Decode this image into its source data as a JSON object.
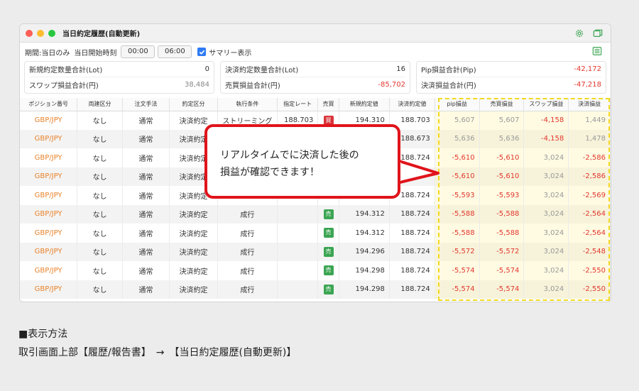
{
  "window": {
    "title": "当日約定履歴(自動更新)",
    "icons": [
      "gear-icon",
      "window-icon"
    ]
  },
  "filter": {
    "period_label": "期間:当日のみ",
    "start_label": "当日開始時刻",
    "time_from": "00:00",
    "time_to": "06:00",
    "summary_label": "サマリー表示",
    "summary_checked": true
  },
  "summary": [
    [
      {
        "label": "新規約定数量合計(Lot)",
        "value": "0"
      },
      {
        "label": "スワップ損益合計(円)",
        "value": "38,484"
      }
    ],
    [
      {
        "label": "決済約定数量合計(Lot)",
        "value": "16"
      },
      {
        "label": "売買損益合計(円)",
        "value": "-85,702"
      }
    ],
    [
      {
        "label": "Pip損益合計(Pip)",
        "value": "-42,172"
      },
      {
        "label": "決済損益合計(円)",
        "value": "-47,218"
      }
    ]
  ],
  "table": {
    "headers": [
      "ポジション番号",
      "両建区分",
      "注文手法",
      "約定区分",
      "執行条件",
      "指定レート",
      "売買",
      "新規約定値",
      "決済約定値",
      "pip損益",
      "売買損益",
      "スワップ損益",
      "決済損益"
    ],
    "rows": [
      [
        "GBP/JPY",
        "なし",
        "通常",
        "決済約定",
        "ストリーミング",
        "188.703",
        "買",
        "194.310",
        "188.703",
        "5,607",
        "5,607",
        "-4,158",
        "1,449"
      ],
      [
        "GBP/JPY",
        "なし",
        "通常",
        "決済約定",
        "",
        "",
        "",
        "",
        "188.673",
        "5,636",
        "5,636",
        "-4,158",
        "1,478"
      ],
      [
        "GBP/JPY",
        "なし",
        "通常",
        "決済約定",
        "",
        "",
        "",
        "",
        "188.724",
        "-5,610",
        "-5,610",
        "3,024",
        "-2,586"
      ],
      [
        "GBP/JPY",
        "なし",
        "通常",
        "決済約定",
        "",
        "",
        "",
        "",
        "",
        "-5,610",
        "-5,610",
        "3,024",
        "-2,586"
      ],
      [
        "GBP/JPY",
        "なし",
        "通常",
        "決済約定",
        "",
        "",
        "",
        "",
        "188.724",
        "-5,593",
        "-5,593",
        "3,024",
        "-2,569"
      ],
      [
        "GBP/JPY",
        "なし",
        "通常",
        "決済約定",
        "成行",
        "",
        "売",
        "194.312",
        "188.724",
        "-5,588",
        "-5,588",
        "3,024",
        "-2,564"
      ],
      [
        "GBP/JPY",
        "なし",
        "通常",
        "決済約定",
        "成行",
        "",
        "売",
        "194.312",
        "188.724",
        "-5,588",
        "-5,588",
        "3,024",
        "-2,564"
      ],
      [
        "GBP/JPY",
        "なし",
        "通常",
        "決済約定",
        "成行",
        "",
        "売",
        "194.296",
        "188.724",
        "-5,572",
        "-5,572",
        "3,024",
        "-2,548"
      ],
      [
        "GBP/JPY",
        "なし",
        "通常",
        "決済約定",
        "成行",
        "",
        "売",
        "194.298",
        "188.724",
        "-5,574",
        "-5,574",
        "3,024",
        "-2,550"
      ],
      [
        "GBP/JPY",
        "なし",
        "通常",
        "決済約定",
        "成行",
        "",
        "売",
        "194.298",
        "188.724",
        "-5,574",
        "-5,574",
        "3,024",
        "-2,550"
      ]
    ]
  },
  "callout": {
    "line1": "リアルタイムでに決済した後の",
    "line2": "損益が確認できます！"
  },
  "caption": {
    "heading": "■表示方法",
    "path": "取引画面上部【履歴/報告書】　→　【当日約定履歴(自動更新)】"
  },
  "colors": {
    "accent": "#e0141b",
    "highlight": "#f3d820",
    "negative": "#e2372e",
    "currency": "#e9832c",
    "sell": "#3ba552",
    "buy": "#d9353a"
  }
}
